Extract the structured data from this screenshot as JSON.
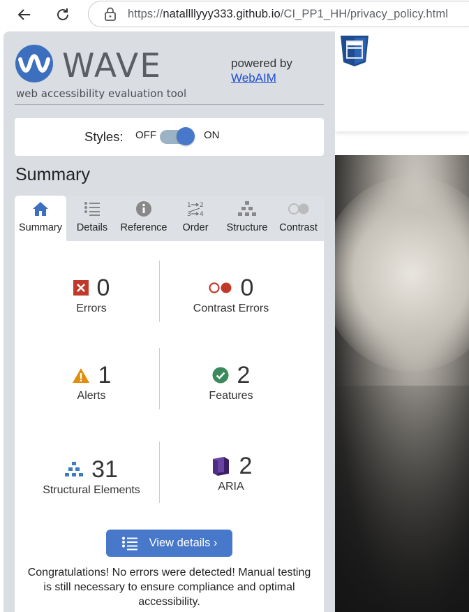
{
  "browser": {
    "url_prefix": "https://",
    "url_host": "natallllyyy333.github.io",
    "url_path": "/CI_PP1_HH/privacy_policy.html"
  },
  "wave": {
    "logo_word": "WAVE",
    "tagline": "web accessibility evaluation tool",
    "powered_by": "powered by",
    "webaim_link": "WebAIM",
    "styles_label": "Styles:",
    "styles_off": "OFF",
    "styles_on": "ON",
    "styles_state": "on",
    "summary_title": "Summary",
    "tabs": [
      {
        "label": "Summary",
        "icon": "home-icon",
        "active": true
      },
      {
        "label": "Details",
        "icon": "list-icon"
      },
      {
        "label": "Reference",
        "icon": "info-icon"
      },
      {
        "label": "Order",
        "icon": "order-icon"
      },
      {
        "label": "Structure",
        "icon": "structure-icon"
      },
      {
        "label": "Contrast",
        "icon": "contrast-icon",
        "disabled": true
      }
    ],
    "stats": {
      "errors": {
        "count": "0",
        "label": "Errors"
      },
      "contrast_errors": {
        "count": "0",
        "label": "Contrast Errors"
      },
      "alerts": {
        "count": "1",
        "label": "Alerts"
      },
      "features": {
        "count": "2",
        "label": "Features"
      },
      "structural": {
        "count": "31",
        "label": "Structural Elements"
      },
      "aria": {
        "count": "2",
        "label": "ARIA"
      }
    },
    "view_details": "View details ›",
    "congrats": "Congratulations! No errors were detected! Manual testing is still necessary to ensure compliance and optimal accessibility."
  },
  "colors": {
    "accent": "#4778c9",
    "error": "#c0392b",
    "alert": "#e08e0b",
    "feature": "#3a8a5b",
    "structure": "#3d7dbf",
    "aria": "#5b3a8c",
    "panel": "#dadde2"
  }
}
